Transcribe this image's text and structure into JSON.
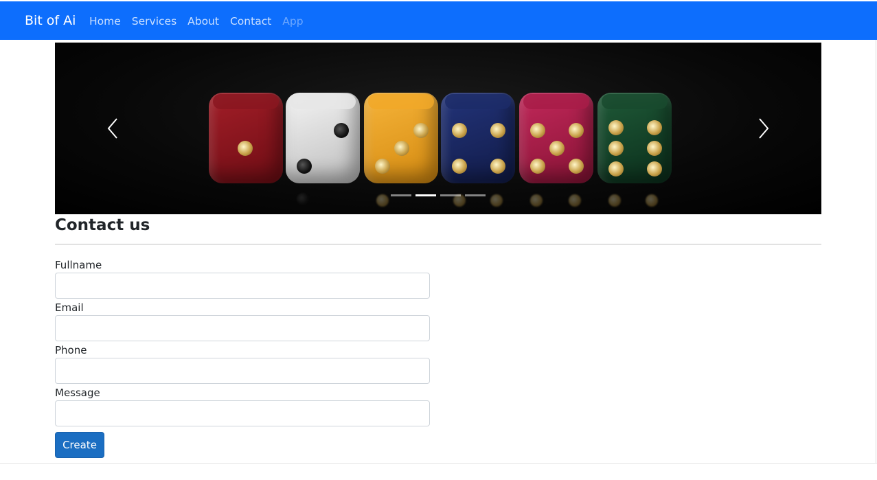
{
  "navbar": {
    "brand": "Bit of Ai",
    "links": [
      {
        "label": "Home"
      },
      {
        "label": "Services"
      },
      {
        "label": "About"
      },
      {
        "label": "Contact"
      },
      {
        "label": "App",
        "disabled": true
      }
    ],
    "color": "#0d6efd"
  },
  "carousel": {
    "image": "colorful dice on black background",
    "prev_icon": "chevron-left-icon",
    "next_icon": "chevron-right-icon",
    "indicators_count": 4,
    "active_indicator": 2
  },
  "page": {
    "title": "Contact us"
  },
  "form": {
    "fields": [
      {
        "label": "Fullname",
        "value": ""
      },
      {
        "label": "Email",
        "value": ""
      },
      {
        "label": "Phone",
        "value": ""
      },
      {
        "label": "Message",
        "value": ""
      }
    ],
    "submit_label": "Create",
    "button_color": "#1b6ec2"
  }
}
